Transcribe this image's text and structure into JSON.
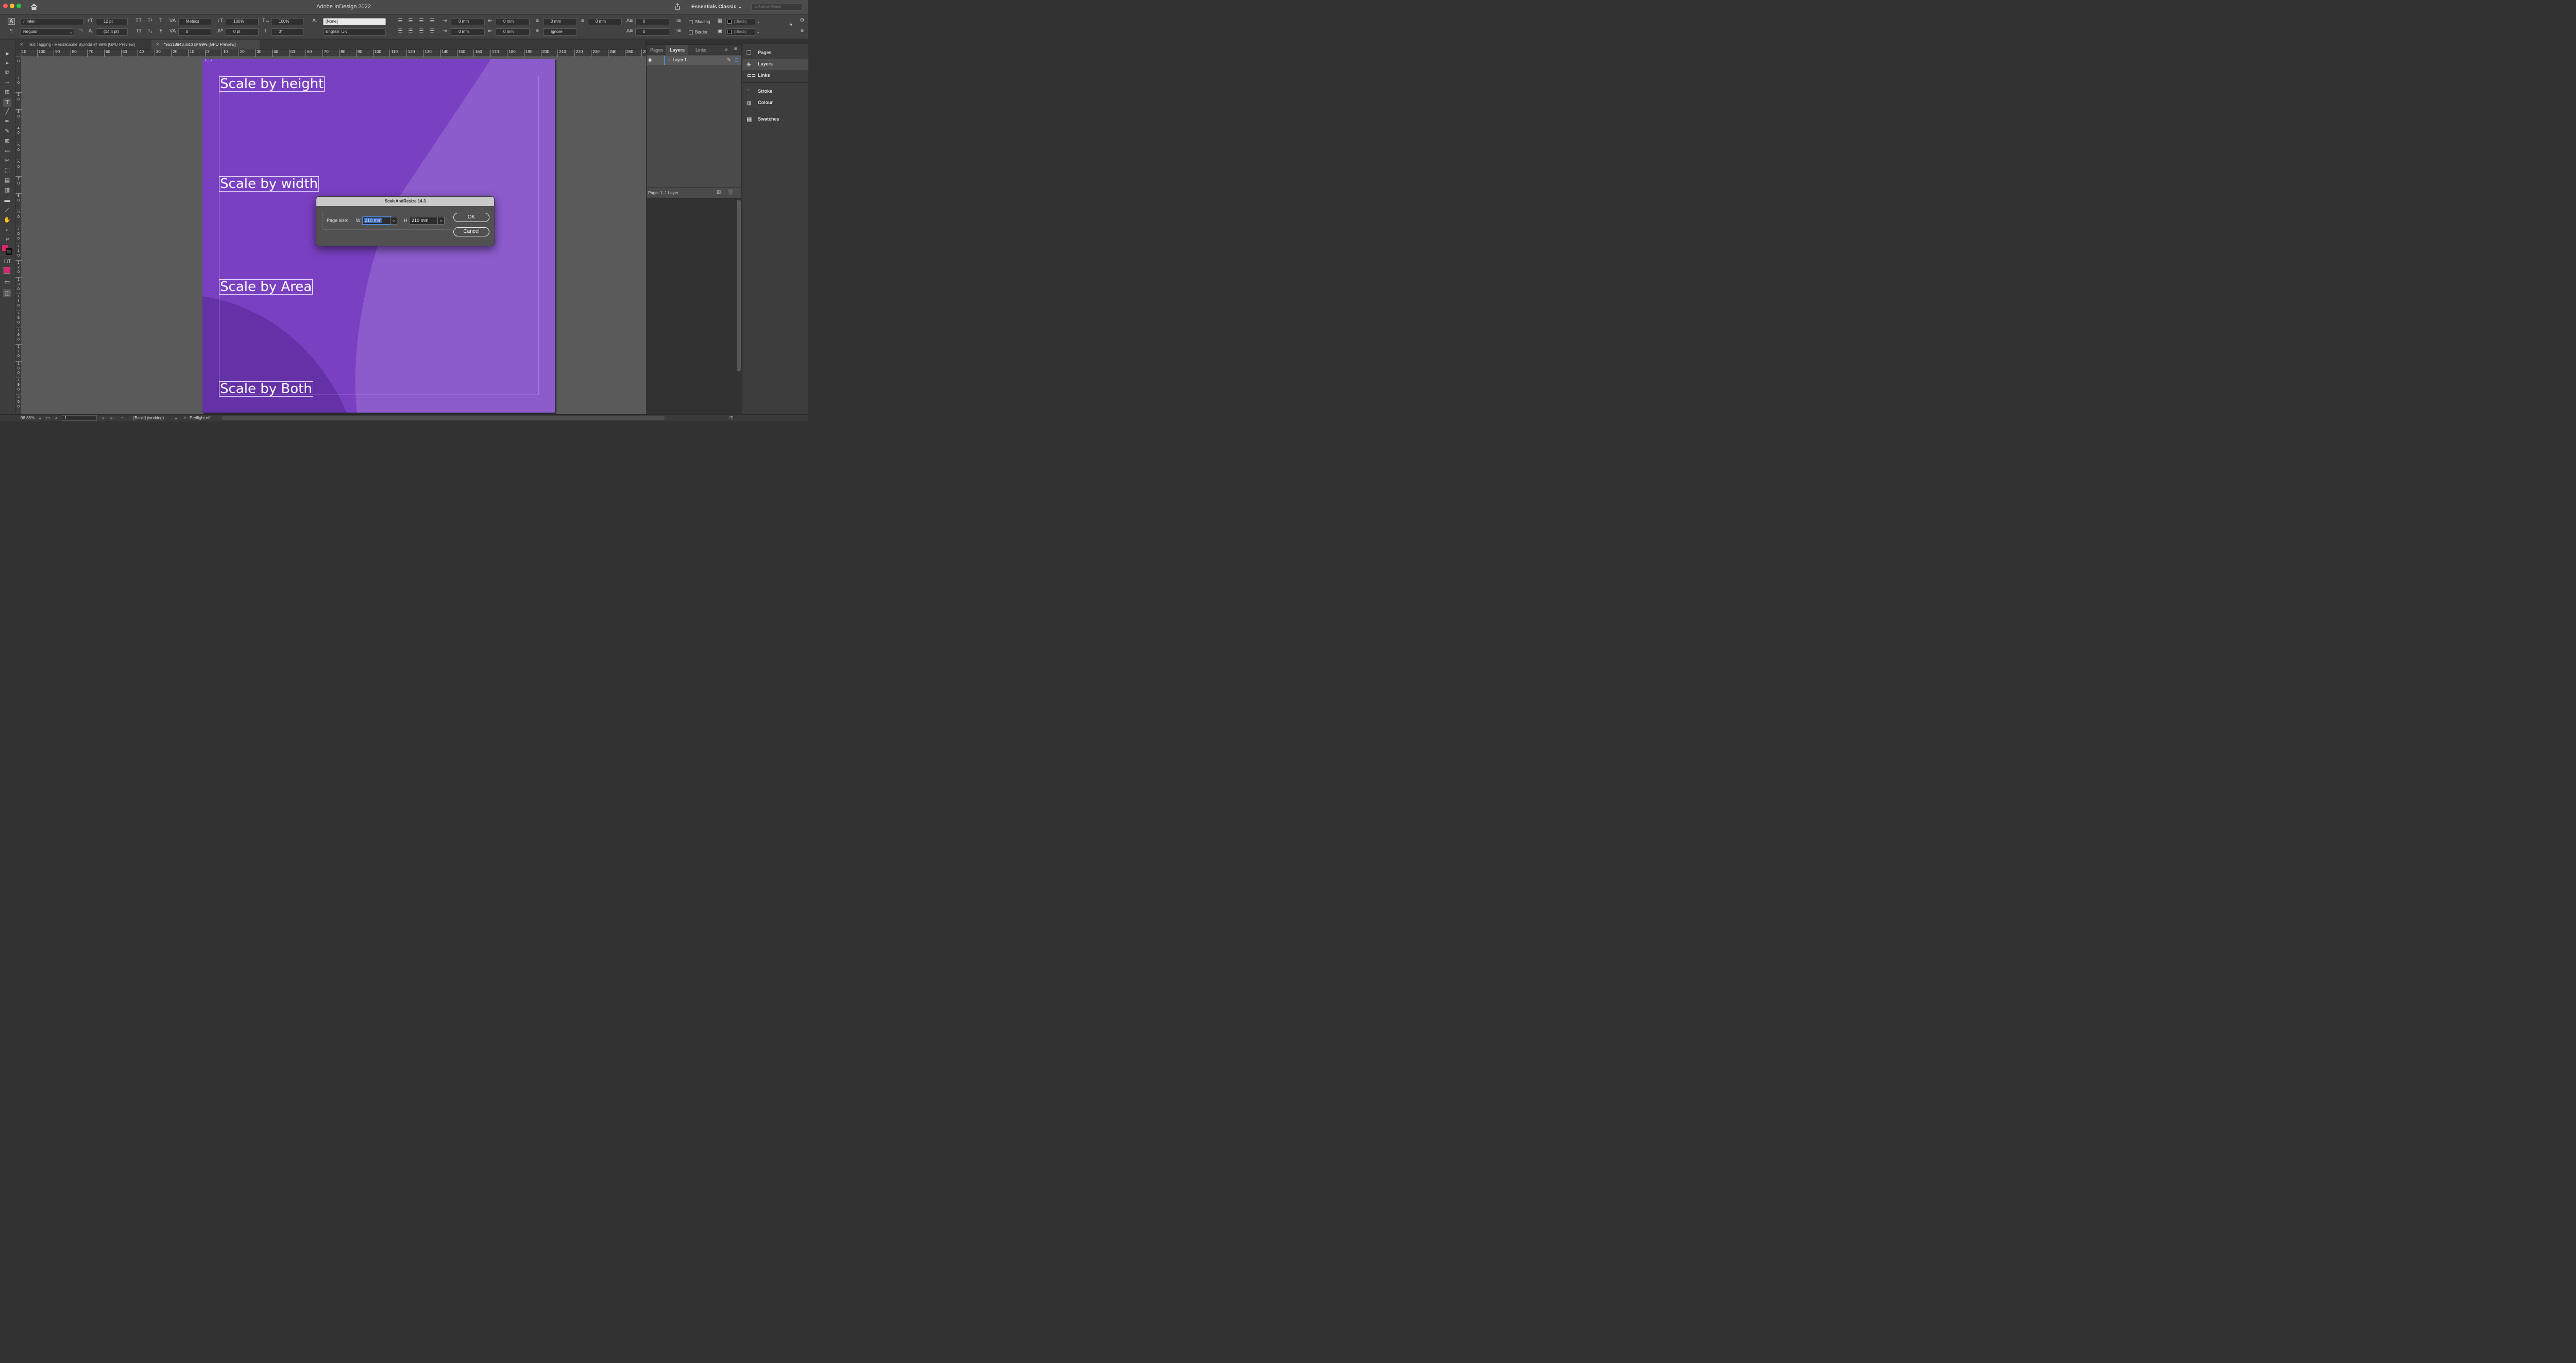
{
  "app": {
    "title": "Adobe InDesign 2022",
    "workspace": "Essentials Classic",
    "stock_search_placeholder": "Adobe Stock"
  },
  "control_panel": {
    "font_family": "Inter",
    "font_style": "Regular",
    "font_size": "12 pt",
    "leading": "(14.4 pt)",
    "kerning": "Metrics",
    "tracking": "0",
    "vertical_scale": "100%",
    "horizontal_scale": "100%",
    "baseline_shift": "0 pt",
    "skew": "0°",
    "char_style": "[None]",
    "language": "English: UK",
    "left_indent": "0 mm",
    "right_indent": "0 mm",
    "first_line_indent": "0 mm",
    "last_line_indent": "0 mm",
    "space_before": "0 mm",
    "space_after": "0 mm",
    "align_to_grid": "Ignore",
    "drop_cap_lines": "0",
    "drop_cap_chars": "0",
    "shading_label": "Shading",
    "border_label": "Border",
    "shading_swatch": "[Black]",
    "border_swatch": "[Black]"
  },
  "tabs": [
    {
      "label": "Text Tagging - ResizeScale By.indd @ 99% [GPU Preview]",
      "active": false
    },
    {
      "label": "*96318943.indd @ 99% [GPU Preview]",
      "active": true
    }
  ],
  "ruler": {
    "h_labels": [
      "10",
      "100",
      "90",
      "80",
      "70",
      "60",
      "50",
      "40",
      "30",
      "20",
      "10",
      "0",
      "10",
      "20",
      "30",
      "40",
      "50",
      "60",
      "70",
      "80",
      "90",
      "100",
      "110",
      "120",
      "130",
      "140",
      "150",
      "160",
      "170",
      "180",
      "190",
      "200",
      "210",
      "220",
      "230",
      "240",
      "250",
      "260"
    ],
    "v_labels": [
      "0",
      "10",
      "20",
      "30",
      "40",
      "50",
      "60",
      "70",
      "80",
      "90",
      "100",
      "110",
      "120",
      "130",
      "140",
      "150",
      "160",
      "170",
      "180",
      "190",
      "200"
    ]
  },
  "document": {
    "page_color": "#7a40c2",
    "text_frames": [
      {
        "text": "Scale by height"
      },
      {
        "text": "Scale by width"
      },
      {
        "text": "Scale by Area"
      },
      {
        "text": "Scale by Both"
      }
    ]
  },
  "dialog": {
    "title": "ScaleAndResize 14.3",
    "page_size_label": "Page size:",
    "w_label": "W",
    "w_value": "210 mm",
    "h_label": "H",
    "h_value": "210 mm",
    "ok_label": "OK",
    "cancel_label": "Cancel"
  },
  "layers_panel": {
    "tabs": [
      "Pages",
      "Layers",
      "Links"
    ],
    "active_tab": "Layers",
    "layer_name": "Layer 1",
    "footer": "Page: 1, 1 Layer"
  },
  "dock": {
    "items": [
      "Pages",
      "Layers",
      "Links",
      "Stroke",
      "Colour",
      "Swatches"
    ]
  },
  "status": {
    "zoom": "98.88%",
    "page": "1",
    "style": "[Basic] (working)",
    "preflight": "Preflight off"
  },
  "colors": {
    "fill_swatch": "#d6276f",
    "accent_selection": "#3b67b8"
  }
}
